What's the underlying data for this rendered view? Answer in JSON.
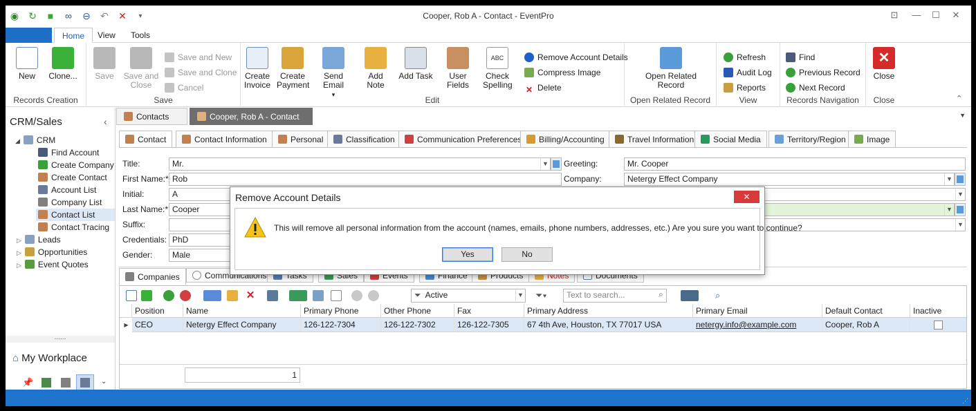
{
  "window": {
    "title": "Cooper, Rob A - Contact - EventPro"
  },
  "menu": {
    "tabs": [
      "Home",
      "View",
      "Tools"
    ]
  },
  "ribbon": {
    "records_creation": {
      "label": "Records Creation",
      "new": "New",
      "clone": "Clone..."
    },
    "save": {
      "label": "Save",
      "save": "Save",
      "save_and_close_1": "Save and",
      "save_and_close_2": "Close",
      "save_and_new": "Save and New",
      "save_and_clone": "Save and Clone",
      "cancel": "Cancel"
    },
    "edit": {
      "label": "Edit",
      "create_invoice_1": "Create",
      "create_invoice_2": "Invoice",
      "create_payment_1": "Create",
      "create_payment_2": "Payment",
      "send_email": "Send Email",
      "add_note": "Add Note",
      "add_task": "Add Task",
      "user_fields": "User Fields",
      "check_spelling_1": "Check",
      "check_spelling_2": "Spelling",
      "remove_account_details": "Remove Account Details",
      "compress_image": "Compress Image",
      "delete": "Delete"
    },
    "open_related": {
      "label": "Open Related Record",
      "button_1": "Open Related",
      "button_2": "Record"
    },
    "view": {
      "label": "View",
      "refresh": "Refresh",
      "audit_log": "Audit Log",
      "reports": "Reports"
    },
    "navigation": {
      "label": "Records Navigation",
      "find": "Find",
      "previous": "Previous Record",
      "next": "Next Record"
    },
    "close": {
      "label": "Close",
      "button": "Close"
    }
  },
  "nav": {
    "header": "CRM/Sales",
    "root": "CRM",
    "items": [
      "Find Account",
      "Create Company",
      "Create Contact",
      "Account List",
      "Company List",
      "Contact List",
      "Contact Tracing"
    ],
    "groups": [
      "Leads",
      "Opportunities",
      "Event Quotes"
    ],
    "workplace": "My Workplace",
    "splitter": "......"
  },
  "doc_tabs": [
    "Contacts",
    "Cooper, Rob A - Contact"
  ],
  "form_tabs": [
    "Contact",
    "Contact Information",
    "Personal",
    "Classification",
    "Communication Preferences",
    "Billing/Accounting",
    "Travel Information",
    "Social Media",
    "Territory/Region",
    "Image"
  ],
  "form": {
    "title_label": "Title:",
    "title_value": "Mr.",
    "first_name_label": "First Name:*",
    "first_name_value": "Rob",
    "initial_label": "Initial:",
    "initial_value": "A",
    "last_name_label": "Last Name:*",
    "last_name_value": "Cooper",
    "suffix_label": "Suffix:",
    "credentials_label": "Credentials:",
    "credentials_value": "PhD",
    "gender_label": "Gender:",
    "gender_value": "Male",
    "greeting_label": "Greeting:",
    "greeting_value": "Mr. Cooper",
    "company_label": "Company:",
    "company_value": "Netergy Effect Company"
  },
  "sub_tabs": [
    "Companies",
    "Communications",
    "Tasks",
    "Sales",
    "Events",
    "Finance",
    "Products",
    "Notes",
    "Documents"
  ],
  "grid_toolbar": {
    "filter_value": "Active",
    "search_placeholder": "Text to search..."
  },
  "grid": {
    "columns": [
      "Position",
      "Name",
      "Primary Phone",
      "Other Phone",
      "Fax",
      "Primary Address",
      "Primary Email",
      "Default Contact",
      "Inactive"
    ],
    "rows": [
      {
        "position": "CEO",
        "name": "Netergy Effect Company",
        "primary_phone": "126-122-7304",
        "other_phone": "126-122-7302",
        "fax": "126-122-7305",
        "address": "67 4th Ave, Houston, TX 77017 USA",
        "email": "netergy.info@example.com",
        "default_contact": "Cooper, Rob A"
      }
    ],
    "record_count": "1"
  },
  "dialog": {
    "title": "Remove Account Details",
    "message": "This will remove all personal information from the account (names, emails, phone numbers, addresses, etc.) Are you sure you want to continue?",
    "yes": "Yes",
    "no": "No"
  },
  "colors": {
    "accent": "#1e73cf",
    "doc_tab_active": "#6e6e6e",
    "selected_row": "#dde8f6",
    "highlight_input": "#e3f5d8"
  }
}
